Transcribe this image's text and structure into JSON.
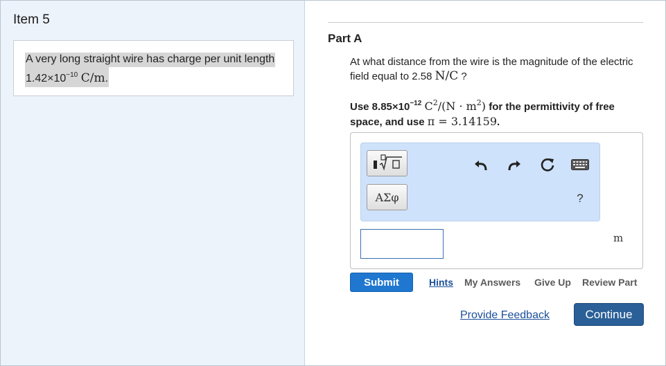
{
  "item": {
    "title": "Item 5"
  },
  "problem": {
    "line1": "A very long straight wire has charge per unit length",
    "value_mantissa": "1.42×10",
    "value_exponent": "−10",
    "value_unit": "C/m",
    "value_end": "."
  },
  "part": {
    "title": "Part A"
  },
  "question": {
    "text_before": "At what distance from the wire is the magnitude of the electric field equal to 2.58",
    "unit": "N/C",
    "text_after": "?"
  },
  "instruction": {
    "use_prefix": "Use 8.85×10",
    "use_exponent": "−12",
    "permittivity_unit": "C",
    "permittivity_unit_rest": "/(N · m",
    "permittivity_unit_close": ")",
    "for_text": "for the permittivity of free space, and use",
    "pi_text": "π = 3.14159",
    "end": "."
  },
  "toolbar": {
    "greek_label": "ΑΣφ",
    "help_label": "?",
    "icons": [
      "template-icon",
      "undo-icon",
      "redo-icon",
      "reset-icon",
      "keyboard-icon",
      "help-icon"
    ]
  },
  "answer": {
    "value": "",
    "unit": "m"
  },
  "actions": {
    "submit": "Submit",
    "hints": "Hints",
    "my_answers": "My Answers",
    "give_up": "Give Up",
    "review_part": "Review Part"
  },
  "footer": {
    "feedback": "Provide Feedback",
    "continue": "Continue"
  },
  "colors": {
    "left_panel_bg": "#edf3fb",
    "toolbar_bg": "#cfe2fb",
    "submit_bg": "#1f77d0",
    "continue_bg": "#2a5f97",
    "link": "#1a4f99"
  }
}
